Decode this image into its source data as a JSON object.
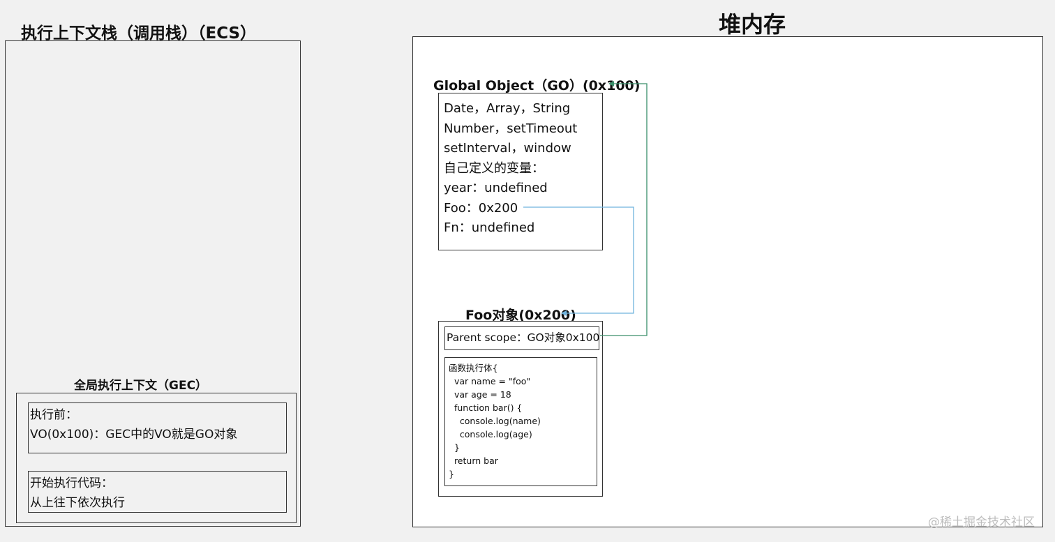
{
  "ecs": {
    "title": "执行上下文栈（调用栈）（ECS）",
    "gec": {
      "title": "全局执行上下文（GEC）",
      "before": {
        "line1": "执行前：",
        "line2": "VO(0x100)：GEC中的VO就是GO对象"
      },
      "start": {
        "line1": "开始执行代码：",
        "line2": "从上往下依次执行"
      }
    }
  },
  "heap": {
    "title": "堆内存",
    "go": {
      "title": "Global Object（GO）(0x100)",
      "lines": [
        "Date，Array，String",
        "Number，setTimeout",
        "setInterval，window",
        "自己定义的变量：",
        "year：undefined",
        "Foo：0x200",
        "Fn：undefined"
      ]
    },
    "foo": {
      "title": "Foo对象(0x200)",
      "parent_scope": "Parent scope：GO对象0x100",
      "body_lines": [
        "函数执行体{",
        "  var name = \"foo\"",
        "  var age = 18",
        "  function bar() {",
        "    console.log(name)",
        "    console.log(age)",
        "  }",
        "  return bar",
        "}"
      ]
    }
  },
  "watermark": "@稀土掘金技术社区",
  "colors": {
    "arrow_green": "#3a8f6b",
    "arrow_blue": "#6fb3dd"
  }
}
